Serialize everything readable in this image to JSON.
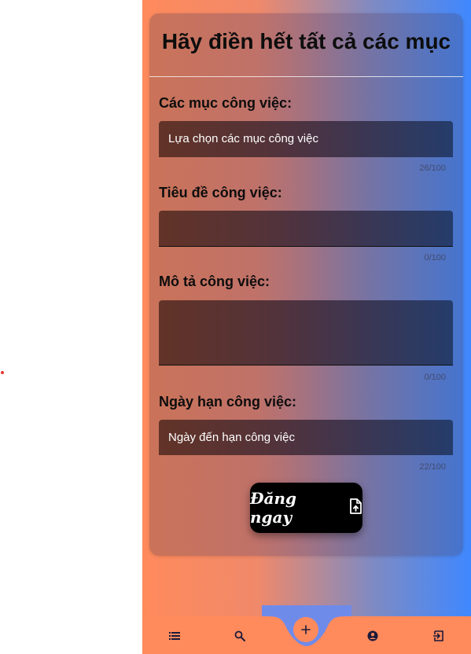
{
  "form": {
    "title": "Hãy điền hết tất cả các mục",
    "category": {
      "label": "Các mục công việc:",
      "value": "Lựa chọn các mục công việc",
      "counter": "26/100"
    },
    "job_title": {
      "label": "Tiêu đề công việc:",
      "value": "",
      "counter": "0/100"
    },
    "description": {
      "label": "Mô tả công việc:",
      "value": "",
      "counter": "0/100"
    },
    "deadline": {
      "label": "Ngày hạn công việc:",
      "value": "Ngày đến hạn công việc",
      "counter": "22/100"
    },
    "submit_label": "Đăng ngay"
  },
  "bottom_nav": {
    "items": [
      {
        "icon": "list-icon"
      },
      {
        "icon": "search-icon"
      },
      {
        "icon": "add-icon"
      },
      {
        "icon": "account-icon"
      },
      {
        "icon": "logout-icon"
      }
    ]
  },
  "colors": {
    "gradient_left": "#ff8a5c",
    "gradient_right": "#3f88ff",
    "button_bg": "#000000"
  }
}
